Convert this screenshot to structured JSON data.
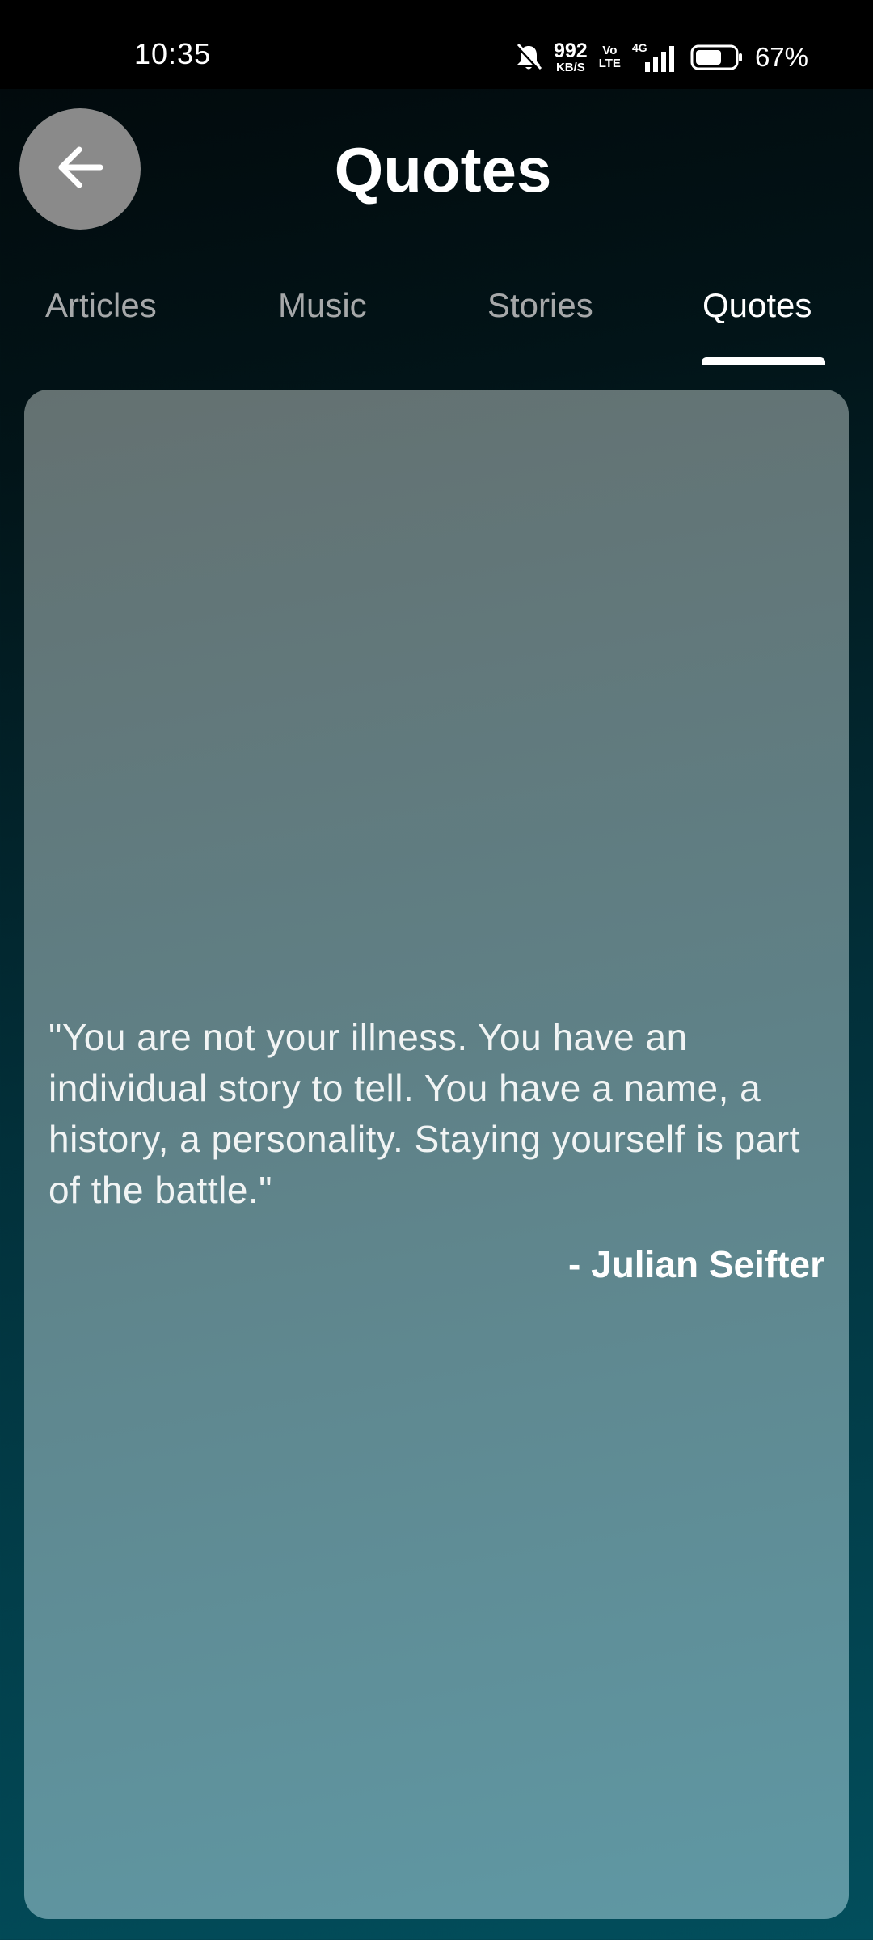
{
  "status_bar": {
    "time": "10:35",
    "net_speed_value": "992",
    "net_speed_unit": "KB/S",
    "volte_top": "Vo",
    "volte_bottom": "LTE",
    "network": "4G",
    "battery_percent": "67%",
    "battery_level": 0.67,
    "icons": [
      "bell-muted-icon",
      "signal-icon",
      "battery-icon"
    ]
  },
  "header": {
    "title": "Quotes",
    "back_icon": "arrow-left-icon"
  },
  "tabs": [
    {
      "label": "Articles",
      "active": false
    },
    {
      "label": "Music",
      "active": false
    },
    {
      "label": "Stories",
      "active": false
    },
    {
      "label": "Quotes",
      "active": true
    }
  ],
  "quote": {
    "text": "\"You are not your illness. You have an individual story to tell. You have a name, a history, a personality. Staying yourself is part of the battle.\"",
    "author": "- Julian Seifter"
  },
  "colors": {
    "card_top": "#647171",
    "card_bottom": "#5f98a4",
    "back_button": "#8a8a8a",
    "active_tab": "#ffffff",
    "inactive_tab": "#a6a8a9"
  }
}
